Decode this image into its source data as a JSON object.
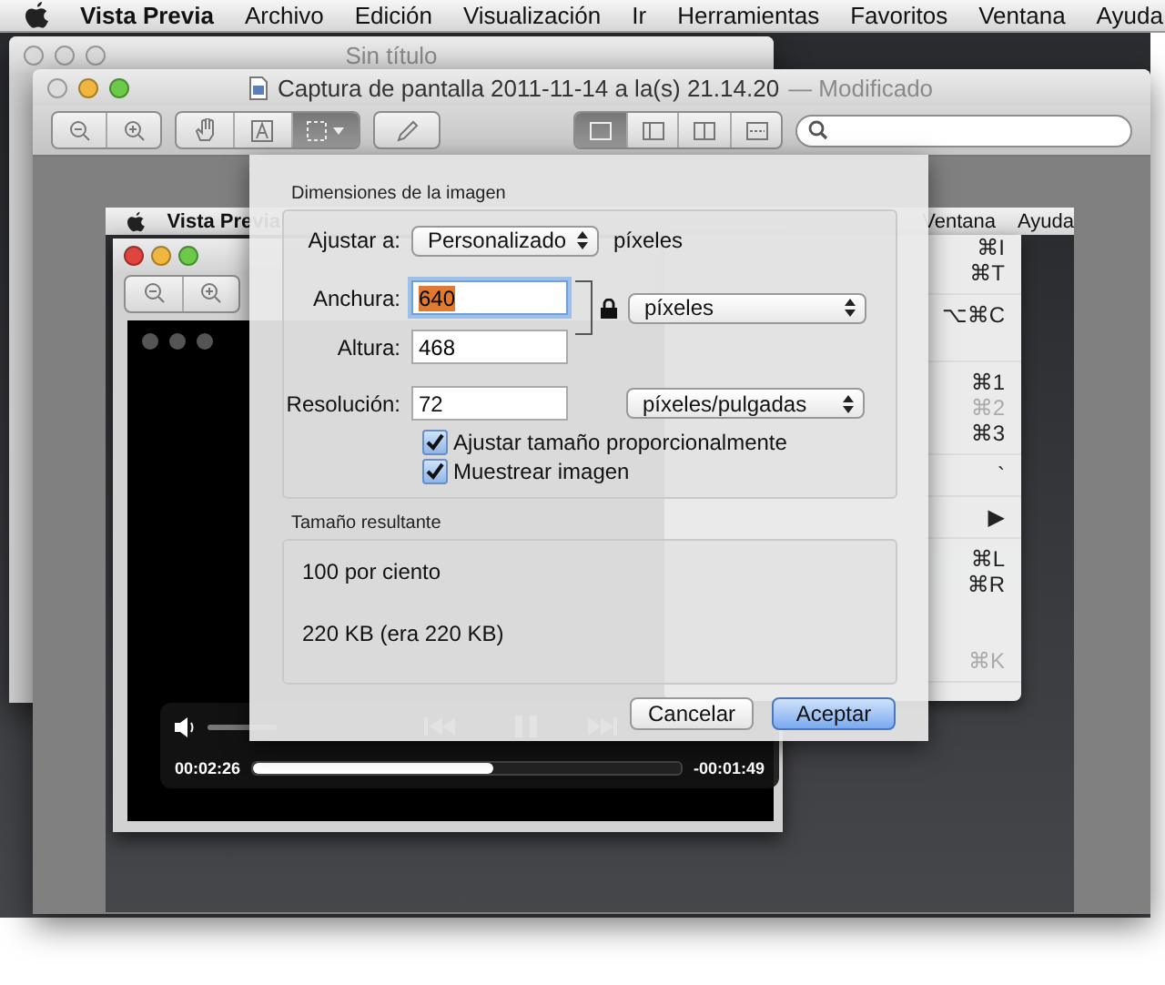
{
  "menubar": {
    "app": "Vista Previa",
    "items": [
      "Archivo",
      "Edición",
      "Visualización",
      "Ir",
      "Herramientas",
      "Favoritos",
      "Ventana",
      "Ayuda"
    ]
  },
  "back_window": {
    "title": "Sin título"
  },
  "window": {
    "title": "Captura de pantalla 2011-11-14 a la(s) 21.14.20",
    "status": "— Modificado"
  },
  "toolbar": {
    "tools": [
      {
        "kind": "hand",
        "selected": false
      },
      {
        "kind": "text",
        "selected": false
      },
      {
        "kind": "select",
        "selected": true
      }
    ],
    "views": [
      {
        "selected": true
      },
      {
        "selected": false
      },
      {
        "selected": false
      },
      {
        "selected": false
      }
    ]
  },
  "screenshot": {
    "menubar": {
      "app": "Vista Previa",
      "items": [
        "Ventana",
        "Ayuda"
      ]
    },
    "menu": [
      {
        "kind": "item",
        "shortcut": "⌘I",
        "disabled": false
      },
      {
        "kind": "item",
        "shortcut": "⌘T",
        "disabled": false
      },
      {
        "kind": "separator"
      },
      {
        "kind": "item",
        "shortcut": "⌥⌘C",
        "disabled": false
      },
      {
        "kind": "spacer"
      },
      {
        "kind": "separator"
      },
      {
        "kind": "item",
        "shortcut": "⌘1",
        "disabled": false
      },
      {
        "kind": "item",
        "shortcut": "⌘2",
        "disabled": true
      },
      {
        "kind": "item",
        "shortcut": "⌘3",
        "disabled": false
      },
      {
        "kind": "separator"
      },
      {
        "kind": "item",
        "shortcut": "`",
        "disabled": false
      },
      {
        "kind": "separator"
      },
      {
        "kind": "item",
        "shortcut": "▶",
        "disabled": false
      },
      {
        "kind": "separator"
      },
      {
        "kind": "item",
        "shortcut": "⌘L",
        "disabled": false
      },
      {
        "kind": "item",
        "shortcut": "⌘R",
        "disabled": false
      },
      {
        "kind": "spacer"
      },
      {
        "kind": "spacer"
      },
      {
        "kind": "item",
        "shortcut": "⌘K",
        "disabled": true
      },
      {
        "kind": "separator"
      }
    ],
    "player": {
      "elapsed": "00:02:26",
      "remaining": "-00:01:49",
      "level": 0.56
    }
  },
  "dialog": {
    "section_title": "Dimensiones de la imagen",
    "fit": {
      "label": "Ajustar a:",
      "value": "Personalizado",
      "unit": "píxeles"
    },
    "width": {
      "label": "Anchura:",
      "value": "640",
      "highlighted": true
    },
    "height": {
      "label": "Altura:",
      "value": "468",
      "highlighted": false
    },
    "locked": true,
    "size_unit": "píxeles",
    "resolution": {
      "label": "Resolución:",
      "value": "72",
      "unit": "píxeles/pulgadas"
    },
    "checkboxes": [
      {
        "label": "Ajustar tamaño proporcionalmente",
        "checked": true
      },
      {
        "label": "Muestrear imagen",
        "checked": true
      }
    ],
    "result": {
      "title": "Tamaño resultante",
      "percent": "100 por ciento",
      "size": "220 KB (era 220 KB)"
    },
    "buttons": [
      {
        "label": "Cancelar",
        "default": false
      },
      {
        "label": "Aceptar",
        "default": true
      }
    ]
  }
}
